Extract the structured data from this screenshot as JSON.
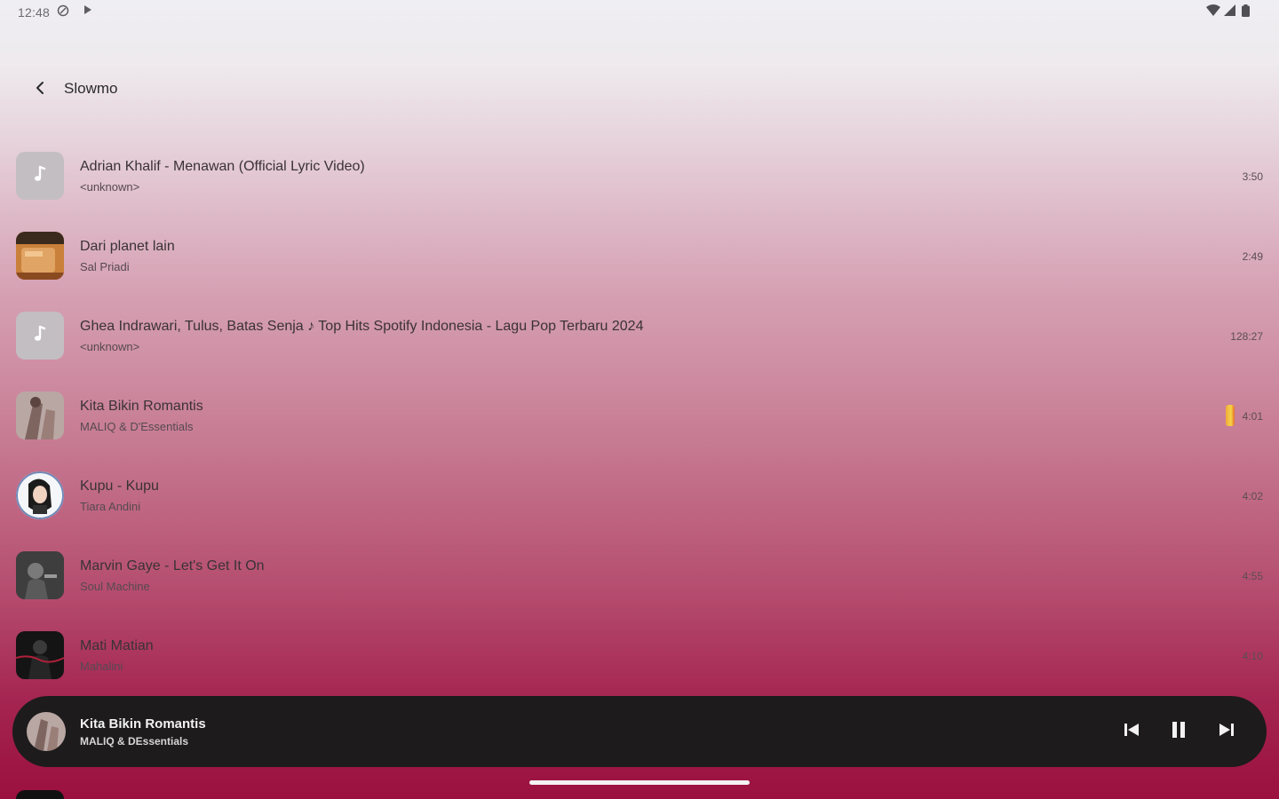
{
  "status_bar": {
    "time": "12:48"
  },
  "header": {
    "title": "Slowmo"
  },
  "tracks": [
    {
      "title": "Adrian Khalif - Menawan (Official Lyric Video)",
      "artist": "<unknown>",
      "duration": "3:50"
    },
    {
      "title": "Dari planet lain",
      "artist": "Sal Priadi",
      "duration": "2:49"
    },
    {
      "title": "Ghea Indrawari, Tulus, Batas Senja ♪ Top Hits Spotify Indonesia - Lagu Pop Terbaru 2024",
      "artist": "<unknown>",
      "duration": "128:27"
    },
    {
      "title": "Kita Bikin Romantis",
      "artist": "MALIQ & D'Essentials",
      "duration": "4:01"
    },
    {
      "title": "Kupu - Kupu",
      "artist": "Tiara Andini",
      "duration": "4:02"
    },
    {
      "title": "Marvin Gaye - Let's Get It On",
      "artist": "Soul Machine",
      "duration": "4:55"
    },
    {
      "title": "Mati Matian",
      "artist": "Mahalini",
      "duration": "4:10"
    }
  ],
  "now_playing": {
    "title": "Kita Bikin Romantis",
    "artist": "MALIQ & DEssentials"
  },
  "colors": {
    "accent_gradient_bottom": "#9b103e",
    "mini_player_bg": "#1d1b1c",
    "playing_indicator": "#f6d348"
  },
  "icons": {
    "back": "chevron-left-icon",
    "previous": "skip-previous-icon",
    "pause": "pause-icon",
    "next": "skip-next-icon",
    "placeholder_art": "music-note-icon"
  }
}
